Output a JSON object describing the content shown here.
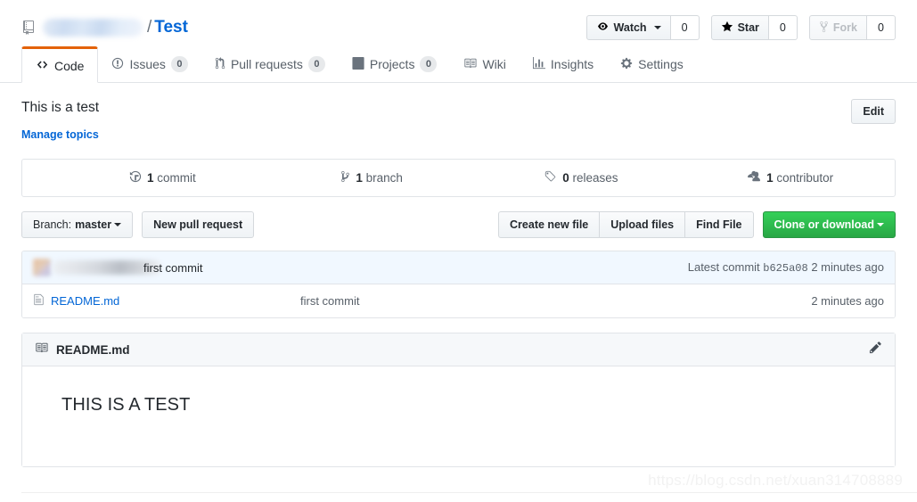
{
  "header": {
    "repo_icon": "repo-icon",
    "owner_redacted": "",
    "separator": "/",
    "repo_name": "Test",
    "watch": {
      "label": "Watch",
      "count": "0",
      "icon": "eye-icon"
    },
    "star": {
      "label": "Star",
      "count": "0",
      "icon": "star-icon"
    },
    "fork": {
      "label": "Fork",
      "count": "0",
      "icon": "fork-icon",
      "disabled": true
    }
  },
  "tabs": [
    {
      "label": "Code",
      "icon": "code-icon",
      "count": null,
      "selected": true
    },
    {
      "label": "Issues",
      "icon": "issue-opened-icon",
      "count": "0",
      "selected": false
    },
    {
      "label": "Pull requests",
      "icon": "git-pull-request-icon",
      "count": "0",
      "selected": false
    },
    {
      "label": "Projects",
      "icon": "project-icon",
      "count": "0",
      "selected": false
    },
    {
      "label": "Wiki",
      "icon": "book-icon",
      "count": null,
      "selected": false
    },
    {
      "label": "Insights",
      "icon": "graph-icon",
      "count": null,
      "selected": false
    },
    {
      "label": "Settings",
      "icon": "gear-icon",
      "count": null,
      "selected": false
    }
  ],
  "about": {
    "description": "This is a test",
    "manage_topics_label": "Manage topics",
    "edit_label": "Edit"
  },
  "numbers": [
    {
      "icon": "history-icon",
      "count": "1",
      "label": "commit"
    },
    {
      "icon": "git-branch-icon",
      "count": "1",
      "label": "branch"
    },
    {
      "icon": "tag-icon",
      "count": "0",
      "label": "releases"
    },
    {
      "icon": "people-icon",
      "count": "1",
      "label": "contributor"
    }
  ],
  "toolbar": {
    "branch_prefix": "Branch:",
    "branch_name": "master",
    "new_pull_request_label": "New pull request",
    "create_new_file_label": "Create new file",
    "upload_files_label": "Upload files",
    "find_file_label": "Find File",
    "clone_or_download_label": "Clone or download",
    "clone_button_color": "#28a745"
  },
  "latest_commit": {
    "author_redacted": "",
    "message": "first commit",
    "meta_prefix": "Latest commit",
    "sha": "b625a08",
    "age": "2 minutes ago"
  },
  "files": [
    {
      "icon": "file-icon",
      "name": "README.md",
      "commit_message": "first commit",
      "age": "2 minutes ago"
    }
  ],
  "readme": {
    "icon": "book-icon",
    "title": "README.md",
    "edit_icon": "pencil-icon",
    "heading": "THIS IS A TEST"
  },
  "watermark": "https://blog.csdn.net/xuan314708889"
}
